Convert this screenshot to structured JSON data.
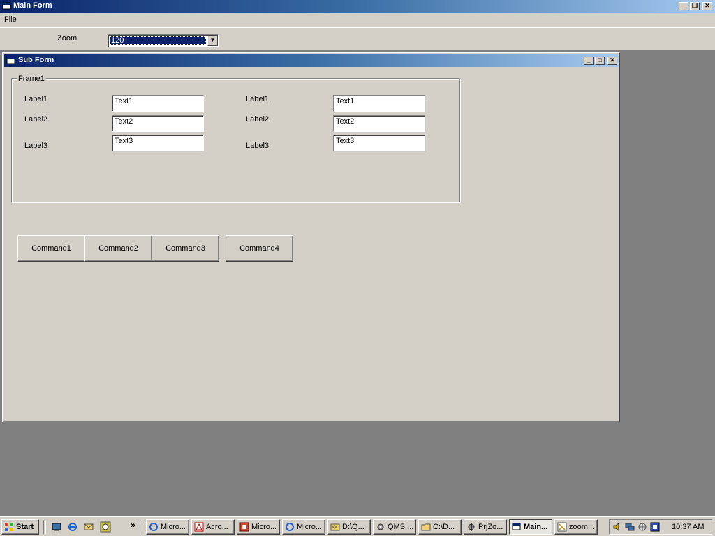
{
  "main_window": {
    "title": "Main Form",
    "menu": [
      "File"
    ],
    "zoom_label": "Zoom",
    "zoom_value": "120"
  },
  "sub_window": {
    "title": "Sub Form",
    "frame_caption": "Frame1",
    "left_column": {
      "labels": [
        "Label1",
        "Label2",
        "Label3"
      ],
      "texts": [
        "Text1",
        "Text2",
        "Text3"
      ]
    },
    "right_column": {
      "labels": [
        "Label1",
        "Label2",
        "Label3"
      ],
      "texts": [
        "Text1",
        "Text2",
        "Text3"
      ]
    },
    "commands": [
      "Command1",
      "Command2",
      "Command3",
      "Command4"
    ]
  },
  "taskbar": {
    "start_label": "Start",
    "overflow_glyph": "»",
    "quicklaunch": [
      "desktop-icon",
      "ie-icon",
      "outlook-icon",
      "clock-icon"
    ],
    "buttons": [
      "Micro...",
      "Acro...",
      "Micro...",
      "Micro...",
      "D:\\Q...",
      "QMS ...",
      "C:\\D...",
      "PrjZo...",
      "Main...",
      "zoom..."
    ],
    "active_button": "Main...",
    "clock": "10:37 AM"
  },
  "colors": {
    "face": "#d4d0c8",
    "desktop": "#808080",
    "title_active": "#0a246a",
    "selection": "#0a246a"
  }
}
